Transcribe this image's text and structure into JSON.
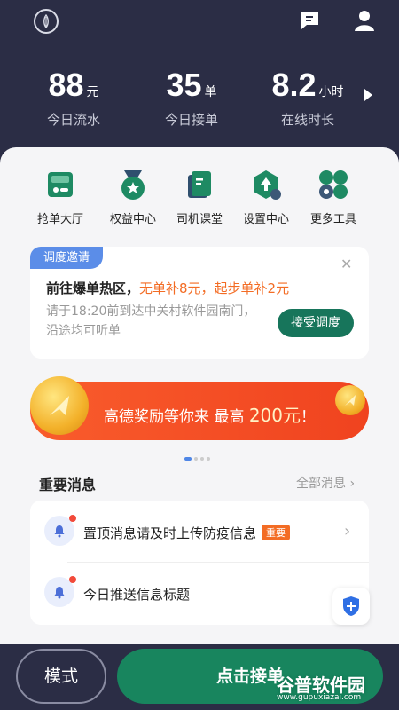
{
  "stats": [
    {
      "value": "88",
      "unit": "元",
      "label": "今日流水"
    },
    {
      "value": "35",
      "unit": "单",
      "label": "今日接单"
    },
    {
      "value": "8.2",
      "unit": "小时",
      "label": "在线时长"
    }
  ],
  "tools": [
    {
      "label": "抢单大厅",
      "icon": "order-hall-icon"
    },
    {
      "label": "权益中心",
      "icon": "medal-icon"
    },
    {
      "label": "司机课堂",
      "icon": "book-icon"
    },
    {
      "label": "设置中心",
      "icon": "settings-icon"
    },
    {
      "label": "更多工具",
      "icon": "more-tools-icon"
    }
  ],
  "dispatch": {
    "tag": "调度邀请",
    "title": "前往爆单热区，",
    "highlight": "无单补8元，起步单补2元",
    "desc": "请于18:20前到达中关村软件园南门，沿途均可听单",
    "accept_label": "接受调度"
  },
  "banner": {
    "text": "高德奖励等你来 最高",
    "amount": "200元",
    "suffix": "！"
  },
  "messages": {
    "header": "重要消息",
    "all_label": "全部消息",
    "items": [
      {
        "text": "置顶消息请及时上传防疫信息",
        "badge": "重要"
      },
      {
        "text": "今日推送信息标题"
      }
    ]
  },
  "bottom": {
    "mode_label": "模式",
    "take_label": "点击接单"
  },
  "watermark": {
    "title": "谷普软件园",
    "url": "www.gupuxiazai.com"
  },
  "colors": {
    "header_bg": "#2b2d45",
    "primary_green": "#17755b",
    "accent_orange": "#f36c24",
    "tag_blue": "#5b8de8"
  }
}
